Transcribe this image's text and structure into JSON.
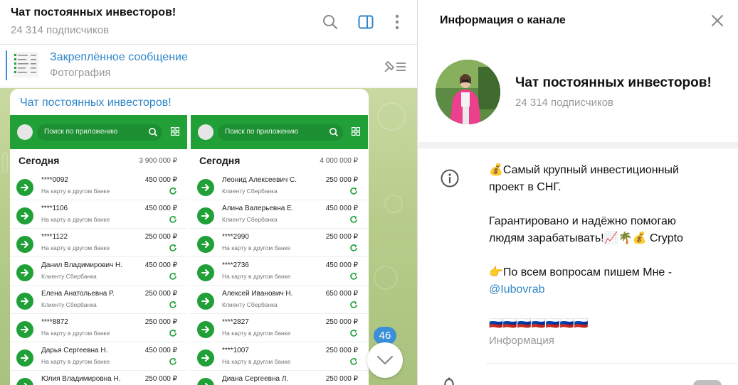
{
  "chat": {
    "title": "Чат постоянных инвесторов!",
    "subscribers": "24 314 подписчиков",
    "pinned_title": "Закреплённое сообщение",
    "pinned_sub": "Фотография",
    "message_author": "Чат постоянных инвесторов!",
    "unread_count": "46",
    "bg_color": "#b7cc8a"
  },
  "phone_left": {
    "search_placeholder": "Поиск по приложению",
    "today": "Сегодня",
    "total": "3 900 000 ₽",
    "rows": [
      {
        "name": "****0092",
        "desc": "На карту в другом банке",
        "amount": "450 000 ₽"
      },
      {
        "name": "****1106",
        "desc": "На карту в другом банке",
        "amount": "450 000 ₽"
      },
      {
        "name": "****1122",
        "desc": "На карту в другом банке",
        "amount": "250 000 ₽"
      },
      {
        "name": "Данил Владимирович Н.",
        "desc": "Клиенту Сбербанка",
        "amount": "450 000 ₽"
      },
      {
        "name": "Елена Анатольевна Р.",
        "desc": "Клиенту Сбербанка",
        "amount": "250 000 ₽"
      },
      {
        "name": "****8872",
        "desc": "На карту в другом банке",
        "amount": "250 000 ₽"
      },
      {
        "name": "Дарья Сергеевна Н.",
        "desc": "На карту в другом банке",
        "amount": "450 000 ₽"
      },
      {
        "name": "Юлия Владимировна Н.",
        "desc": "",
        "amount": "250 000 ₽"
      }
    ]
  },
  "phone_right": {
    "search_placeholder": "Поиск по приложению",
    "today": "Сегодня",
    "total": "4 000 000 ₽",
    "rows": [
      {
        "name": "Леонид Алексеевич С.",
        "desc": "Клиенту Сбербанка",
        "amount": "250 000 ₽"
      },
      {
        "name": "Алина Валерьевна Е.",
        "desc": "Клиенту Сбербанка",
        "amount": "450 000 ₽"
      },
      {
        "name": "****2990",
        "desc": "На карту в другом банке",
        "amount": "250 000 ₽"
      },
      {
        "name": "****2736",
        "desc": "На карту в другом банке",
        "amount": "450 000 ₽"
      },
      {
        "name": "Алексей Иванович Н.",
        "desc": "Клиенту Сбербанка",
        "amount": "650 000 ₽"
      },
      {
        "name": "****2827",
        "desc": "На карту в другом банке",
        "amount": "250 000 ₽"
      },
      {
        "name": "****1007",
        "desc": "На карту в другом банке",
        "amount": "250 000 ₽"
      },
      {
        "name": "Диана Сергеевна Л.",
        "desc": "",
        "amount": "250 000 ₽"
      }
    ]
  },
  "info": {
    "header_title": "Информация о канале",
    "channel_name": "Чат постоянных инвесторов!",
    "subscribers": "24 314 подписчиков",
    "about_lines": [
      "💰Самый крупный инвестиционный",
      "проект в СНГ.",
      "",
      "Гарантировано и надёжно помогаю",
      "людям зарабатывать!📈🌴💰 Crypto",
      "",
      "👉По всем вопросам пишем Мне -"
    ],
    "about_link": "@Iubovrab",
    "about_flags": "🇷🇺🇷🇺🇷🇺🇷🇺🇷🇺🇷🇺🇷🇺",
    "about_label": "Информация"
  },
  "colors": {
    "accent": "#2e86c9",
    "sber_green": "#21a038",
    "badge": "#3a8fd8"
  },
  "icons": [
    "search-icon",
    "sidebar-toggle-icon",
    "more-vertical-icon",
    "unpin-list-icon",
    "chevron-down-icon",
    "close-icon",
    "info-icon",
    "bell-icon"
  ]
}
